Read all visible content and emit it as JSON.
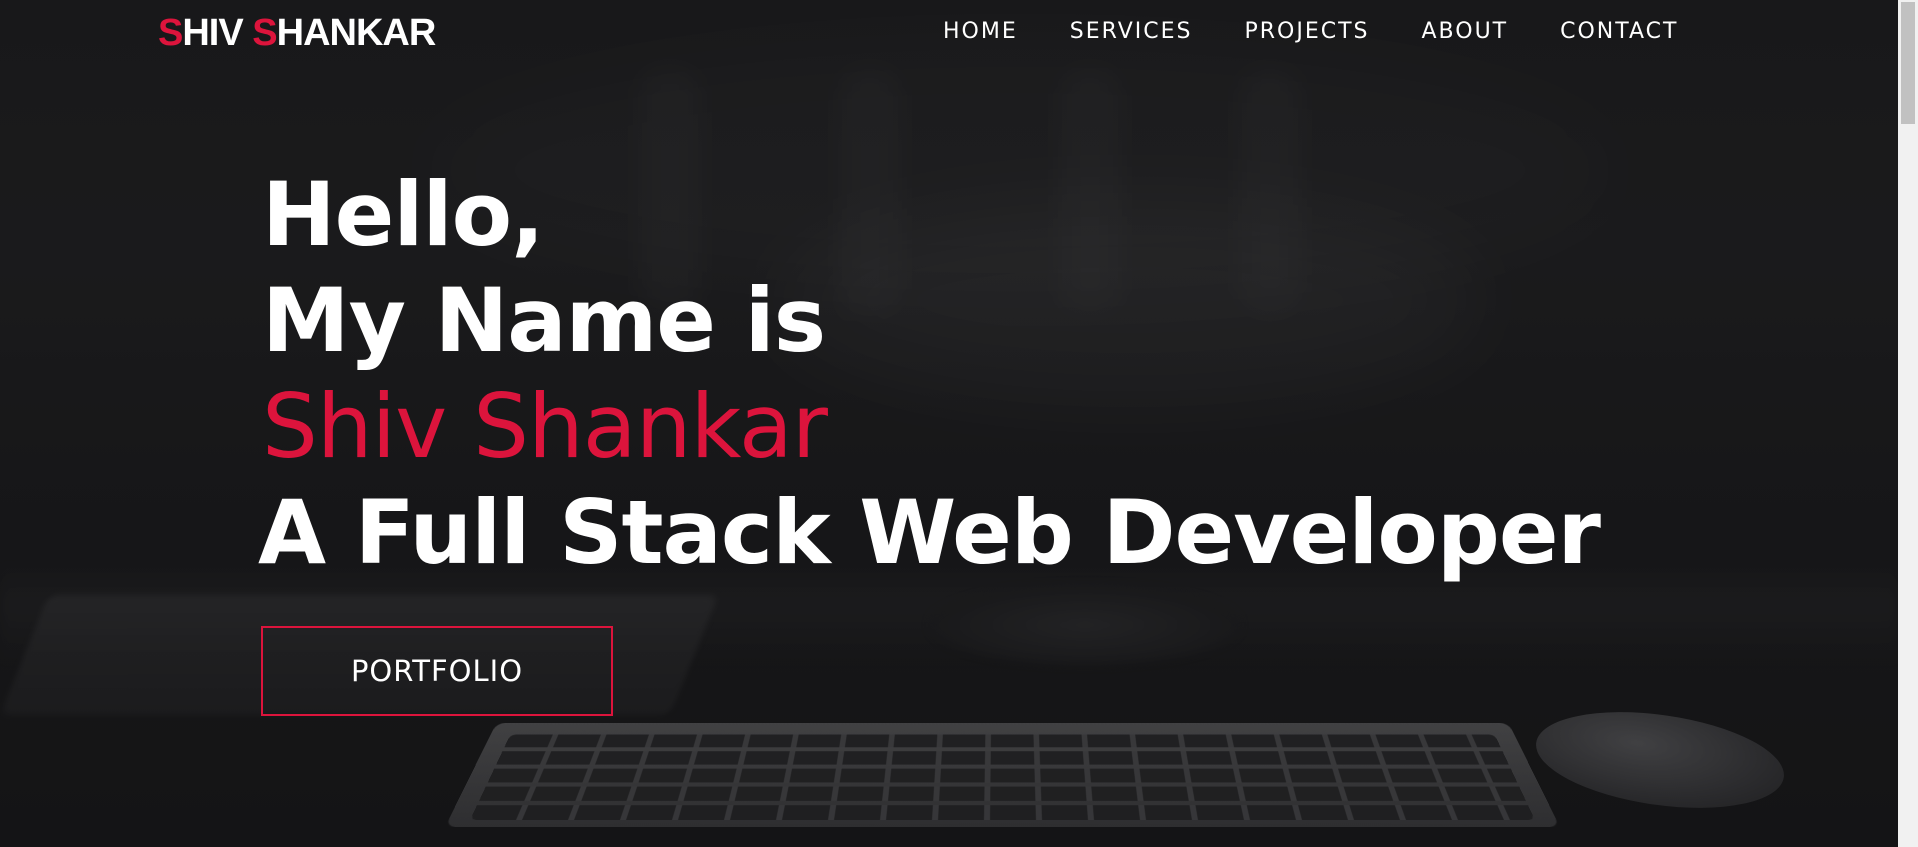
{
  "brand": {
    "first_initial": "S",
    "first_rest": "HIV ",
    "last_initial": "S",
    "last_rest": "HANKAR",
    "accent_color": "#dc143c"
  },
  "nav": {
    "items": [
      {
        "label": "HOME"
      },
      {
        "label": "SERVICES"
      },
      {
        "label": "PROJECTS"
      },
      {
        "label": "ABOUT"
      },
      {
        "label": "CONTACT"
      }
    ]
  },
  "hero": {
    "greeting": "Hello,",
    "intro": "My Name is",
    "name": "Shiv Shankar",
    "role": "A Full Stack Web Developer",
    "cta_label": "PORTFOLIO"
  },
  "colors": {
    "background": "#1b1b1c",
    "text": "#ffffff",
    "accent": "#dc143c"
  }
}
